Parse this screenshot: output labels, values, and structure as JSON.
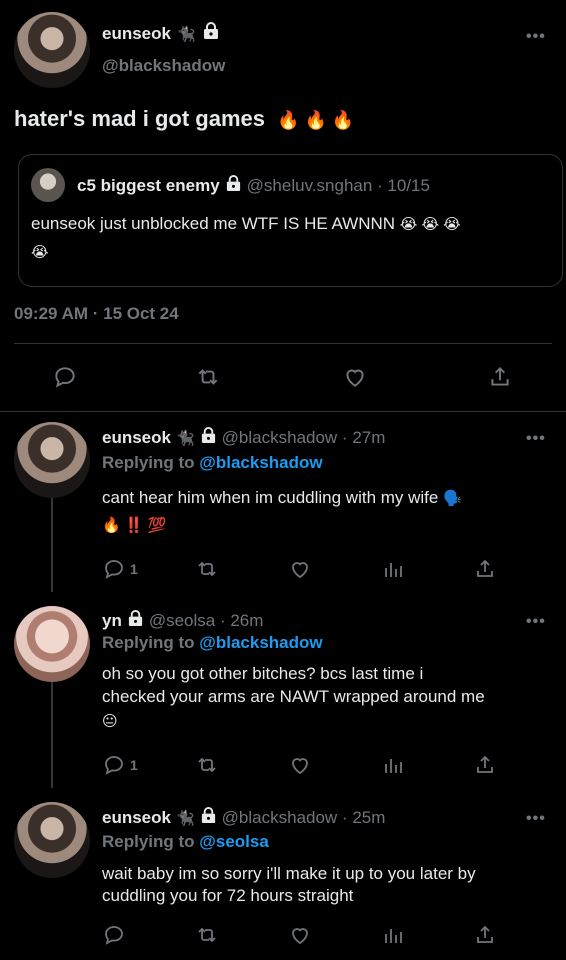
{
  "main_tweet": {
    "name": "eunseok",
    "name_emoji": "🐈‍⬛",
    "handle": "@blackshadow",
    "text": "hater's mad i got games",
    "text_emojis": "🔥 🔥 🔥",
    "timestamp": "09:29 AM · 15 Oct 24",
    "more": "•••",
    "quote": {
      "name": "c5 biggest enemy",
      "handle_time": "@sheluv.snghan · 10/15",
      "text": "eunseok just unblocked me WTF IS HE AWNNN",
      "emojis": "😭 😭 😭",
      "emoji_line2": "😭"
    }
  },
  "replies": [
    {
      "name": "eunseok",
      "name_emoji": "🐈‍⬛",
      "handle_time": "@blackshadow · 27m",
      "replying_prefix": "Replying to",
      "replying_handle": "@blackshadow",
      "line1": "cant hear him when im cuddling with my wife",
      "line1_emoji": "🗣️",
      "line2": "🔥 ‼️ 💯",
      "reply_count": "1",
      "more": "•••"
    },
    {
      "name": "yn",
      "handle_time": "@seolsa · 26m",
      "replying_prefix": "Replying to",
      "replying_handle": "@blackshadow",
      "line1": "oh so you got other bitches? bcs last time i",
      "line2": "checked your arms are NAWT wrapped around me",
      "line3": "😐",
      "reply_count": "1",
      "more": "•••"
    },
    {
      "name": "eunseok",
      "name_emoji": "🐈‍⬛",
      "handle_time": "@blackshadow · 25m",
      "replying_prefix": "Replying to",
      "replying_handle": "@seolsa",
      "line1": "wait baby im so sorry i'll make it up to you later by",
      "line2": "cuddling you for 72 hours straight",
      "more": "•••"
    }
  ],
  "colors": {
    "background": "#000000",
    "text": "#e7e9ea",
    "muted": "#71767b",
    "link": "#1d9bf0",
    "divider": "#2f3336"
  }
}
